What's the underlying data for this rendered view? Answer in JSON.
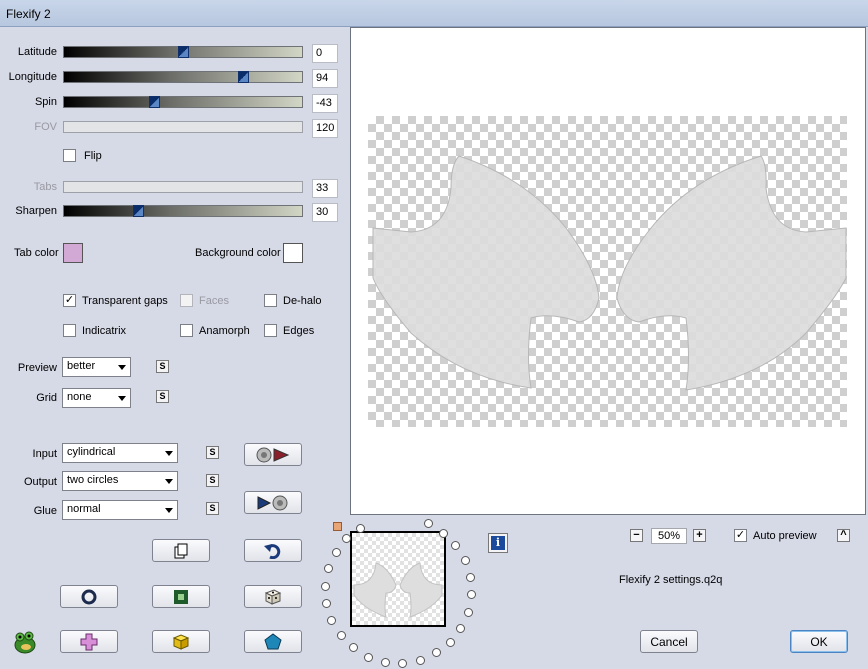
{
  "window": {
    "title": "Flexify 2"
  },
  "sliders": [
    {
      "id": "latitude",
      "label": "Latitude",
      "value": "0",
      "fraction": 0.5,
      "enabled": true
    },
    {
      "id": "longitude",
      "label": "Longitude",
      "value": "94",
      "fraction": 0.75,
      "enabled": true
    },
    {
      "id": "spin",
      "label": "Spin",
      "value": "-43",
      "fraction": 0.38,
      "enabled": true
    },
    {
      "id": "fov",
      "label": "FOV",
      "value": "120",
      "enabled": false
    }
  ],
  "flip": {
    "label": "Flip",
    "checked": false
  },
  "tabs_slider": {
    "label": "Tabs",
    "value": "33",
    "enabled": false
  },
  "sharpen_slider": {
    "label": "Sharpen",
    "value": "30",
    "fraction": 0.31,
    "enabled": true
  },
  "colors": {
    "tab_label": "Tab color",
    "tab_value": "#d2a8d4",
    "bg_label": "Background color",
    "bg_value": "#ffffff"
  },
  "options": [
    {
      "label": "Transparent gaps",
      "checked": true,
      "enabled": true
    },
    {
      "label": "Faces",
      "checked": false,
      "enabled": false
    },
    {
      "label": "De-halo",
      "checked": false,
      "enabled": true
    },
    {
      "label": "Indicatrix",
      "checked": false,
      "enabled": true
    },
    {
      "label": "Anamorph",
      "checked": false,
      "enabled": true
    },
    {
      "label": "Edges",
      "checked": false,
      "enabled": true
    }
  ],
  "dropdowns": {
    "preview": {
      "label": "Preview",
      "value": "better"
    },
    "grid": {
      "label": "Grid",
      "value": "none"
    },
    "input": {
      "label": "Input",
      "value": "cylindrical"
    },
    "output": {
      "label": "Output",
      "value": "two circles"
    },
    "glue": {
      "label": "Glue",
      "value": "normal"
    }
  },
  "s_button_label": "S",
  "zoom": {
    "value": "50%",
    "minus": "−",
    "plus": "+"
  },
  "auto_preview": {
    "label": "Auto preview",
    "checked": true
  },
  "settings_file": "Flexify 2 settings.q2q",
  "buttons": {
    "cancel": "Cancel",
    "ok": "OK",
    "info": "i",
    "collapse": "^"
  },
  "icon_names": [
    "input-forward-icon",
    "output-back-icon",
    "copy-icon",
    "undo-icon",
    "circle-icon",
    "square-icon",
    "dice-icon",
    "frog-icon",
    "cross-icon",
    "cube-icon",
    "pentagon-icon"
  ]
}
